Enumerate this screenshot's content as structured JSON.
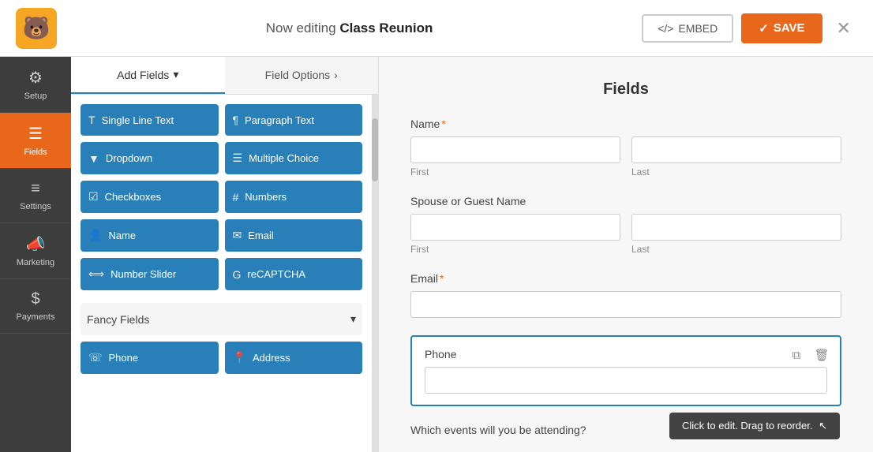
{
  "topbar": {
    "logo_emoji": "🐻",
    "editing_prefix": "Now editing ",
    "form_name": "Class Reunion",
    "embed_label": "EMBED",
    "embed_icon": "</>",
    "save_label": "SAVE",
    "save_icon": "✓",
    "close_icon": "✕"
  },
  "sidebar_nav": [
    {
      "id": "setup",
      "label": "Setup",
      "icon": "⚙",
      "active": false
    },
    {
      "id": "fields",
      "label": "Fields",
      "icon": "☰",
      "active": true
    },
    {
      "id": "settings",
      "label": "Settings",
      "icon": "≡",
      "active": false
    },
    {
      "id": "marketing",
      "label": "Marketing",
      "icon": "📣",
      "active": false
    },
    {
      "id": "payments",
      "label": "Payments",
      "icon": "$",
      "active": false
    }
  ],
  "tabs": [
    {
      "id": "add-fields",
      "label": "Add Fields",
      "active": true,
      "arrow": "▾"
    },
    {
      "id": "field-options",
      "label": "Field Options",
      "active": false,
      "arrow": "›"
    }
  ],
  "field_buttons": [
    {
      "id": "single-line",
      "icon": "T",
      "label": "Single Line Text"
    },
    {
      "id": "paragraph",
      "icon": "¶",
      "label": "Paragraph Text"
    },
    {
      "id": "dropdown",
      "icon": "▼",
      "label": "Dropdown"
    },
    {
      "id": "multiple-choice",
      "icon": "☰",
      "label": "Multiple Choice"
    },
    {
      "id": "checkboxes",
      "icon": "☑",
      "label": "Checkboxes"
    },
    {
      "id": "numbers",
      "icon": "#",
      "label": "Numbers"
    },
    {
      "id": "name",
      "icon": "👤",
      "label": "Name"
    },
    {
      "id": "email",
      "icon": "✉",
      "label": "Email"
    },
    {
      "id": "number-slider",
      "icon": "⟺",
      "label": "Number Slider"
    },
    {
      "id": "recaptcha",
      "icon": "G",
      "label": "reCAPTCHA"
    }
  ],
  "fancy_section": {
    "title": "Fancy Fields",
    "expanded": false,
    "arrow": "▾",
    "buttons": [
      {
        "id": "phone",
        "icon": "☏",
        "label": "Phone"
      },
      {
        "id": "address",
        "icon": "📍",
        "label": "Address"
      }
    ]
  },
  "form_preview": {
    "title": "Fields",
    "sections": [
      {
        "id": "name",
        "label": "Name",
        "required": true,
        "type": "name-row",
        "sub_labels": [
          "First",
          "Last"
        ]
      },
      {
        "id": "spouse-guest",
        "label": "Spouse or Guest Name",
        "required": false,
        "type": "name-row",
        "sub_labels": [
          "First",
          "Last"
        ]
      },
      {
        "id": "email",
        "label": "Email",
        "required": true,
        "type": "single"
      },
      {
        "id": "phone",
        "label": "Phone",
        "required": false,
        "type": "phone",
        "highlighted": true
      }
    ],
    "which_events_label": "Which events will you be attending?"
  },
  "tooltip": {
    "text": "Click to edit. Drag to reorder."
  },
  "phone_actions": {
    "copy_icon": "⧉",
    "delete_icon": "🗑"
  }
}
